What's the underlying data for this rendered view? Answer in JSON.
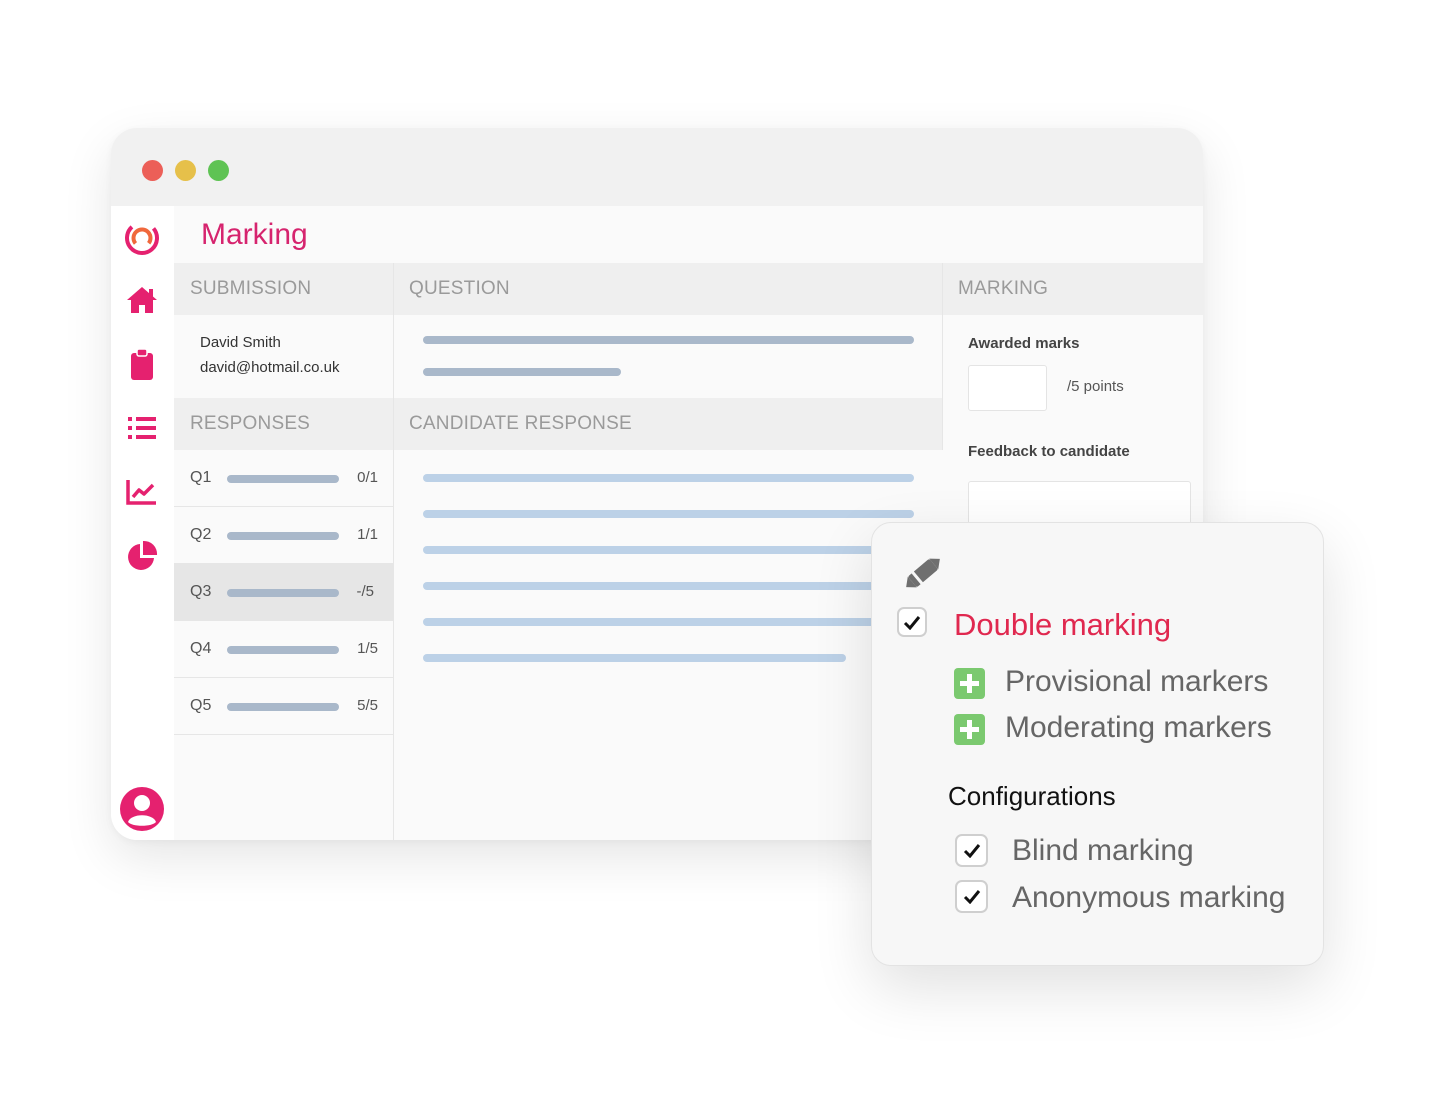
{
  "window": {
    "controls": [
      "close-dot",
      "minimize-dot",
      "maximize-dot"
    ]
  },
  "sidebar": {
    "icons": [
      "logo-icon",
      "home-icon",
      "clipboard-icon",
      "list-icon",
      "chart-line-icon",
      "pie-chart-icon",
      "user-avatar-icon"
    ],
    "accent_color": "#e5216f"
  },
  "page": {
    "title": "Marking"
  },
  "columns": {
    "submission": "SUBMISSION",
    "question": "QUESTION",
    "marking": "MARKING",
    "responses": "RESPONSES",
    "candidate_response": "CANDIDATE RESPONSE"
  },
  "submission": {
    "name": "David Smith",
    "email": "david@hotmail.co.uk"
  },
  "responses": [
    {
      "label": "Q1",
      "score": "0/1"
    },
    {
      "label": "Q2",
      "score": "1/1"
    },
    {
      "label": "Q3",
      "score": "-/5",
      "selected": true
    },
    {
      "label": "Q4",
      "score": "1/5"
    },
    {
      "label": "Q5",
      "score": "5/5"
    }
  ],
  "marking": {
    "awarded_label": "Awarded marks",
    "awarded_value": "",
    "points_suffix": "/5 points",
    "feedback_label": "Feedback to candidate",
    "feedback_value": ""
  },
  "popup": {
    "icon": "pen-icon",
    "double_marking": {
      "label": "Double marking",
      "checked": true
    },
    "markers": [
      {
        "label": "Provisional markers",
        "icon": "add-icon"
      },
      {
        "label": "Moderating markers",
        "icon": "add-icon"
      }
    ],
    "configurations_title": "Configurations",
    "configurations": [
      {
        "label": "Blind marking",
        "checked": true
      },
      {
        "label": "Anonymous marking",
        "checked": true
      }
    ]
  },
  "colors": {
    "brand_pink": "#d6246e",
    "double_marking_red": "#e0284f",
    "add_green": "#7bc96f"
  }
}
